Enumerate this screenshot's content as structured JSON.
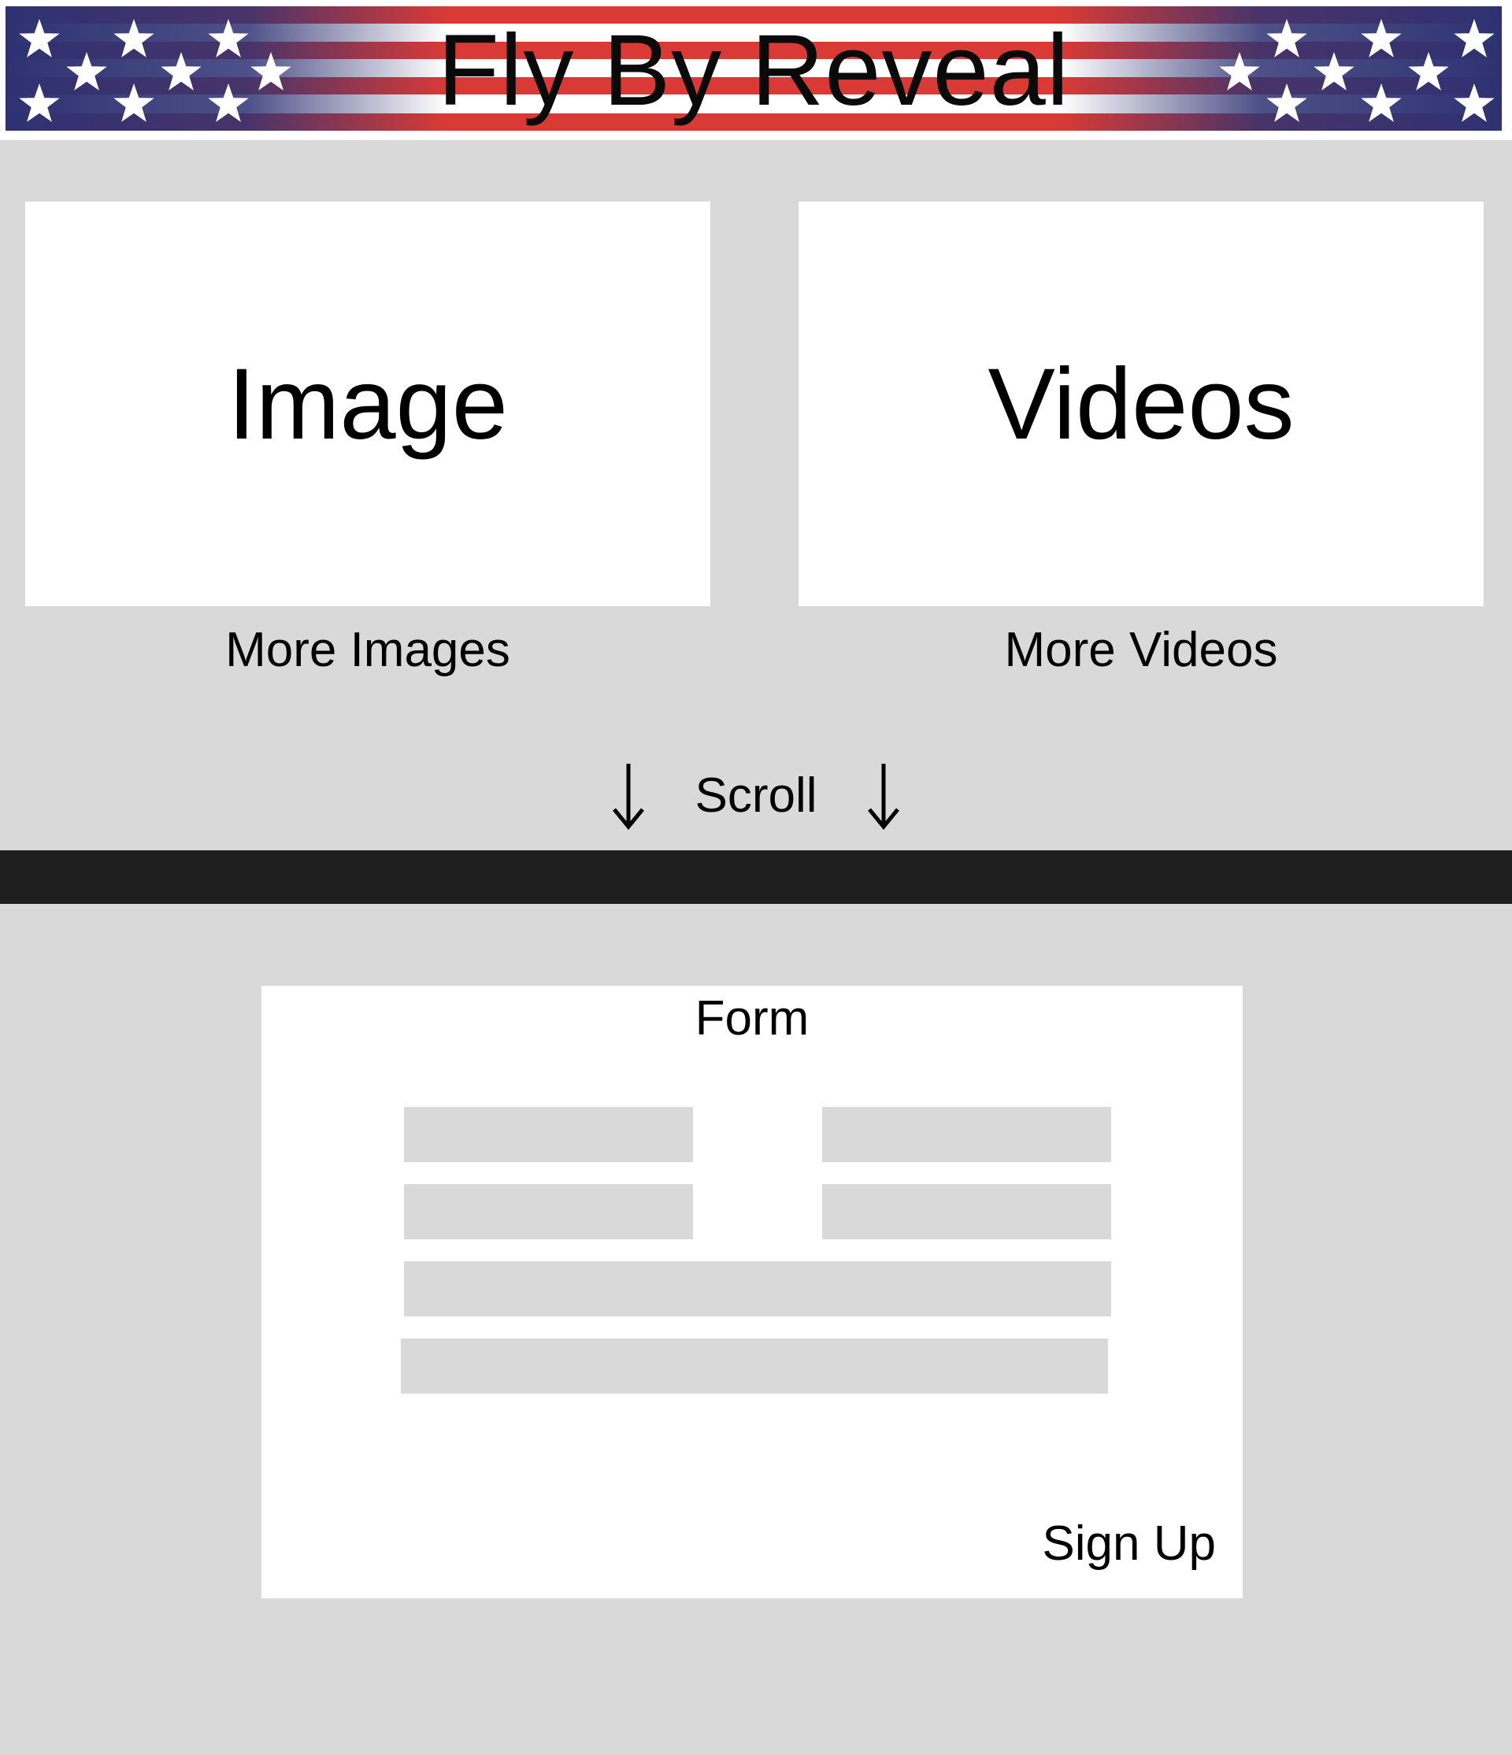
{
  "header": {
    "title": "Fly By Reveal",
    "banner_colors": {
      "blue": "#2e3272",
      "red": "#d93a35",
      "white": "#ffffff"
    }
  },
  "gallery": {
    "image_card_label": "Image",
    "video_card_label": "Videos",
    "more_images_label": "More Images",
    "more_videos_label": "More Videos"
  },
  "scroll": {
    "label": "Scroll",
    "icons": [
      "arrow-down-icon",
      "arrow-down-icon"
    ]
  },
  "form": {
    "title": "Form",
    "fields": [
      {
        "name": "field-1",
        "value": ""
      },
      {
        "name": "field-2",
        "value": ""
      },
      {
        "name": "field-3",
        "value": ""
      },
      {
        "name": "field-4",
        "value": ""
      },
      {
        "name": "field-5",
        "value": ""
      },
      {
        "name": "field-6",
        "value": ""
      }
    ],
    "submit_label": "Sign Up"
  },
  "colors": {
    "page_background": "#d9d9d9",
    "card_background": "#ffffff",
    "divider": "#1e1e1e"
  }
}
